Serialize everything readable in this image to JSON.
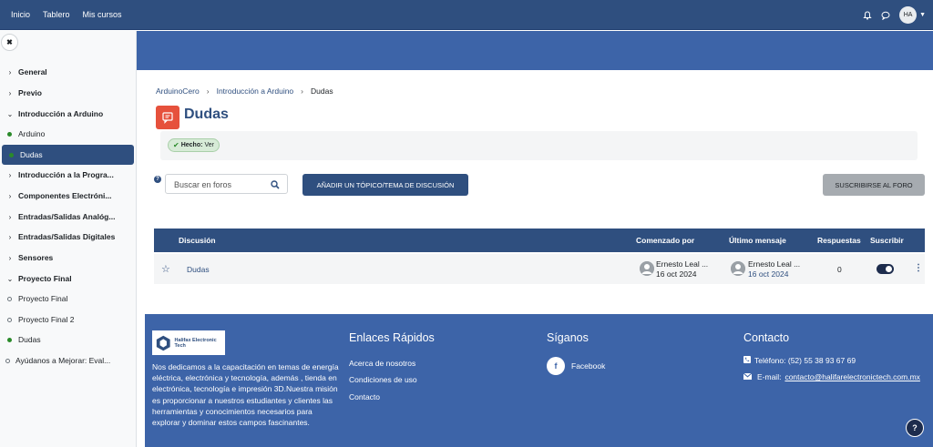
{
  "topnav": {
    "home": "Inicio",
    "dashboard": "Tablero",
    "my_courses": "Mis cursos"
  },
  "user": {
    "initials": "HA"
  },
  "sidebar": {
    "items": [
      {
        "label": "General",
        "type": "section"
      },
      {
        "label": "Previo",
        "type": "section"
      },
      {
        "label": "Introducción a Arduino",
        "type": "section-open"
      },
      {
        "label": "Arduino",
        "type": "activity",
        "status": "done"
      },
      {
        "label": "Dudas",
        "type": "activity",
        "status": "done",
        "active": true
      },
      {
        "label": "Introducción a la Progra...",
        "type": "section"
      },
      {
        "label": "Componentes Electróni...",
        "type": "section"
      },
      {
        "label": "Entradas/Salidas Analóg...",
        "type": "section"
      },
      {
        "label": "Entradas/Salidas Digitales",
        "type": "section"
      },
      {
        "label": "Sensores",
        "type": "section"
      },
      {
        "label": "Proyecto Final",
        "type": "section-open"
      },
      {
        "label": "Proyecto Final",
        "type": "activity",
        "status": "pending"
      },
      {
        "label": "Proyecto Final 2",
        "type": "activity",
        "status": "pending"
      },
      {
        "label": "Dudas",
        "type": "activity",
        "status": "done"
      },
      {
        "label": "Ayúdanos a Mejorar: Eval...",
        "type": "activity",
        "status": "pending"
      }
    ]
  },
  "breadcrumb": {
    "items": [
      "ArduinoCero",
      "Introducción a Arduino",
      "Dudas"
    ]
  },
  "page": {
    "title": "Dudas",
    "completion": {
      "label": "Hecho:",
      "value": "Ver"
    }
  },
  "forum": {
    "search_placeholder": "Buscar en foros",
    "add_button": "AÑADIR UN TÓPICO/TEMA DE DISCUSIÓN",
    "subscribe_button": "SUSCRIBIRSE AL FORO",
    "columns": {
      "discussion": "Discusión",
      "started_by": "Comenzado por",
      "last_post": "Último mensaje",
      "replies": "Respuestas",
      "subscribe": "Suscribir"
    },
    "rows": [
      {
        "title": "Dudas",
        "started_name": "Ernesto Leal ...",
        "started_date": "16 oct 2024",
        "last_name": "Ernesto Leal ...",
        "last_date": "16 oct 2024",
        "replies": "0",
        "subscribed": true
      }
    ]
  },
  "footer": {
    "logo_text": "Halifax Electronic Tech",
    "about": "Nos dedicamos a la capacitación en temas de energía eléctrica, electrónica y tecnología, además , tienda en electrónica, tecnología e impresión 3D.Nuestra misión es proporcionar a nuestros estudiantes y clientes las herramientas y conocimientos necesarios para explorar y dominar estos campos fascinantes.",
    "quick_links_title": "Enlaces Rápidos",
    "quick_links": [
      "Acerca de nosotros",
      "Condiciones de uso",
      "Contacto"
    ],
    "follow_title": "Síganos",
    "facebook": "Facebook",
    "contact_title": "Contacto",
    "phone": "Teléfono: (52) 55 38 93 67 69",
    "email_label": "E-mail:",
    "email": "contacto@halifarelectronictech.com.mx"
  },
  "colors": {
    "navy": "#2f4f7f",
    "banner": "#3d64a8",
    "accent_red": "#e6513c"
  }
}
